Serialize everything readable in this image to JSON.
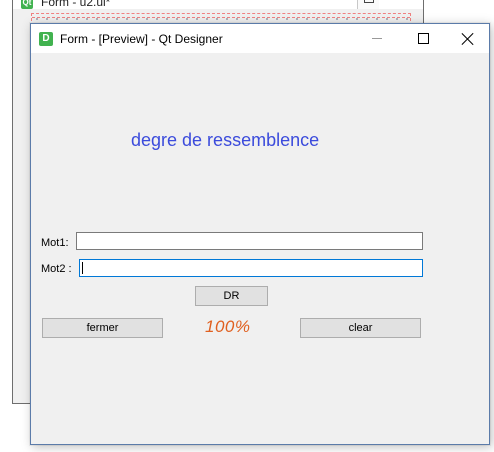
{
  "background_window": {
    "icon_text": "Qt",
    "title": "Form - u2.ui*"
  },
  "preview_window": {
    "icon_text": "D",
    "title": "Form - [Preview] - Qt Designer",
    "controls": {
      "minimize": "minimize-icon",
      "maximize": "maximize-icon",
      "close": "close-icon"
    }
  },
  "form": {
    "heading": "degre de ressemblence",
    "word1_label": "Mot1:",
    "word1_value": "",
    "word2_label": "Mot2 :",
    "word2_value": "",
    "dr_button": "DR",
    "close_button": "fermer",
    "result": "100%",
    "clear_button": "clear"
  },
  "colors": {
    "heading": "#3b4bdc",
    "result": "#e06020",
    "focus_border": "#0078d7",
    "qt_green": "#41b24f"
  }
}
